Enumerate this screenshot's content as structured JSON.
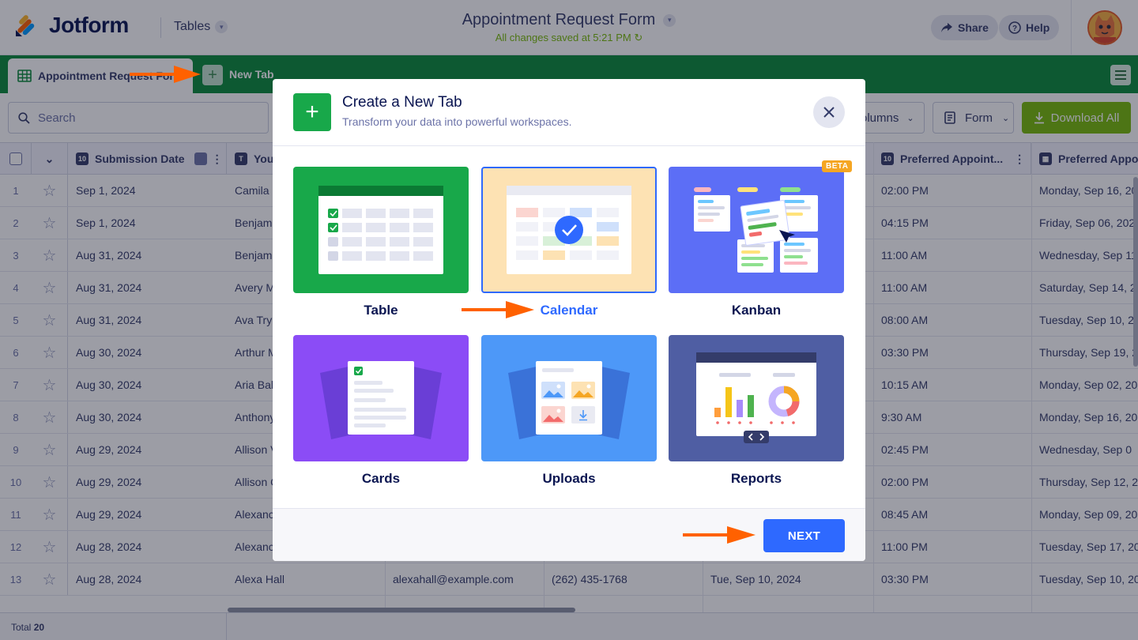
{
  "header": {
    "brand": "Jotform",
    "tables_menu": "Tables",
    "form_title": "Appointment Request Form",
    "save_status": "All changes saved at 5:21 PM",
    "share_label": "Share",
    "help_label": "Help"
  },
  "tabs": {
    "active_label": "Appointment Request Form",
    "new_tab_label": "New Tab"
  },
  "toolbar": {
    "search_placeholder": "Search",
    "columns_label": "olumns",
    "form_label": "Form",
    "download_label": "Download All"
  },
  "grid": {
    "headers": [
      "Submission Date",
      "You",
      "Preferred Appoint...",
      "Preferred Appo"
    ],
    "rows": [
      {
        "n": "1",
        "date": "Sep 1, 2024",
        "name": "Camila",
        "email": "",
        "phone": "",
        "pdate": "",
        "time": "02:00 PM",
        "pref": "Monday, Sep 16, 20"
      },
      {
        "n": "2",
        "date": "Sep 1, 2024",
        "name": "Benjam",
        "email": "",
        "phone": "",
        "pdate": "",
        "time": "04:15 PM",
        "pref": "Friday, Sep 06, 202"
      },
      {
        "n": "3",
        "date": "Aug 31, 2024",
        "name": "Benjam",
        "email": "",
        "phone": "",
        "pdate": "",
        "time": "11:00 AM",
        "pref": "Wednesday, Sep 11"
      },
      {
        "n": "4",
        "date": "Aug 31, 2024",
        "name": "Avery M",
        "email": "",
        "phone": "",
        "pdate": "",
        "time": "11:00 AM",
        "pref": "Saturday, Sep 14, 2"
      },
      {
        "n": "5",
        "date": "Aug 31, 2024",
        "name": "Ava Try",
        "email": "",
        "phone": "",
        "pdate": "",
        "time": "08:00 AM",
        "pref": "Tuesday, Sep 10, 20"
      },
      {
        "n": "6",
        "date": "Aug 30, 2024",
        "name": "Arthur M",
        "email": "",
        "phone": "",
        "pdate": "",
        "time": "03:30 PM",
        "pref": "Thursday, Sep 19, 2"
      },
      {
        "n": "7",
        "date": "Aug 30, 2024",
        "name": "Aria Bak",
        "email": "",
        "phone": "",
        "pdate": "",
        "time": "10:15 AM",
        "pref": "Monday, Sep 02, 20"
      },
      {
        "n": "8",
        "date": "Aug 30, 2024",
        "name": "Anthony",
        "email": "",
        "phone": "",
        "pdate": "",
        "time": "9:30 AM",
        "pref": "Monday, Sep 16, 20"
      },
      {
        "n": "9",
        "date": "Aug 29, 2024",
        "name": "Allison V",
        "email": "",
        "phone": "",
        "pdate": "",
        "time": "02:45 PM",
        "pref": "Wednesday, Sep 0"
      },
      {
        "n": "10",
        "date": "Aug 29, 2024",
        "name": "Allison C",
        "email": "",
        "phone": "",
        "pdate": "",
        "time": "02:00 PM",
        "pref": "Thursday, Sep 12, 2"
      },
      {
        "n": "11",
        "date": "Aug 29, 2024",
        "name": "Alexanc",
        "email": "",
        "phone": "",
        "pdate": "",
        "time": "08:45 AM",
        "pref": "Monday, Sep 09, 20"
      },
      {
        "n": "12",
        "date": "Aug 28, 2024",
        "name": "Alexanc",
        "email": "",
        "phone": "",
        "pdate": "",
        "time": "11:00 PM",
        "pref": "Tuesday, Sep 17, 20"
      },
      {
        "n": "13",
        "date": "Aug 28, 2024",
        "name": "Alexa Hall",
        "email": "alexahall@example.com",
        "phone": "(262) 435-1768",
        "pdate": "Tue, Sep 10, 2024",
        "time": "03:30 PM",
        "pref": "Tuesday, Sep 10, 20"
      }
    ]
  },
  "footer": {
    "total_label": "Total",
    "total_count": "20"
  },
  "modal": {
    "title": "Create a New Tab",
    "subtitle": "Transform your data into powerful workspaces.",
    "beta_badge": "BETA",
    "next_label": "NEXT",
    "options": [
      "Table",
      "Calendar",
      "Kanban",
      "Cards",
      "Uploads",
      "Reports"
    ],
    "selected": "Calendar"
  },
  "colors": {
    "brand_green": "#0a8a3a",
    "accent_blue": "#2e69ff",
    "download_green": "#78bb07",
    "arrow_orange": "#ff6100"
  }
}
